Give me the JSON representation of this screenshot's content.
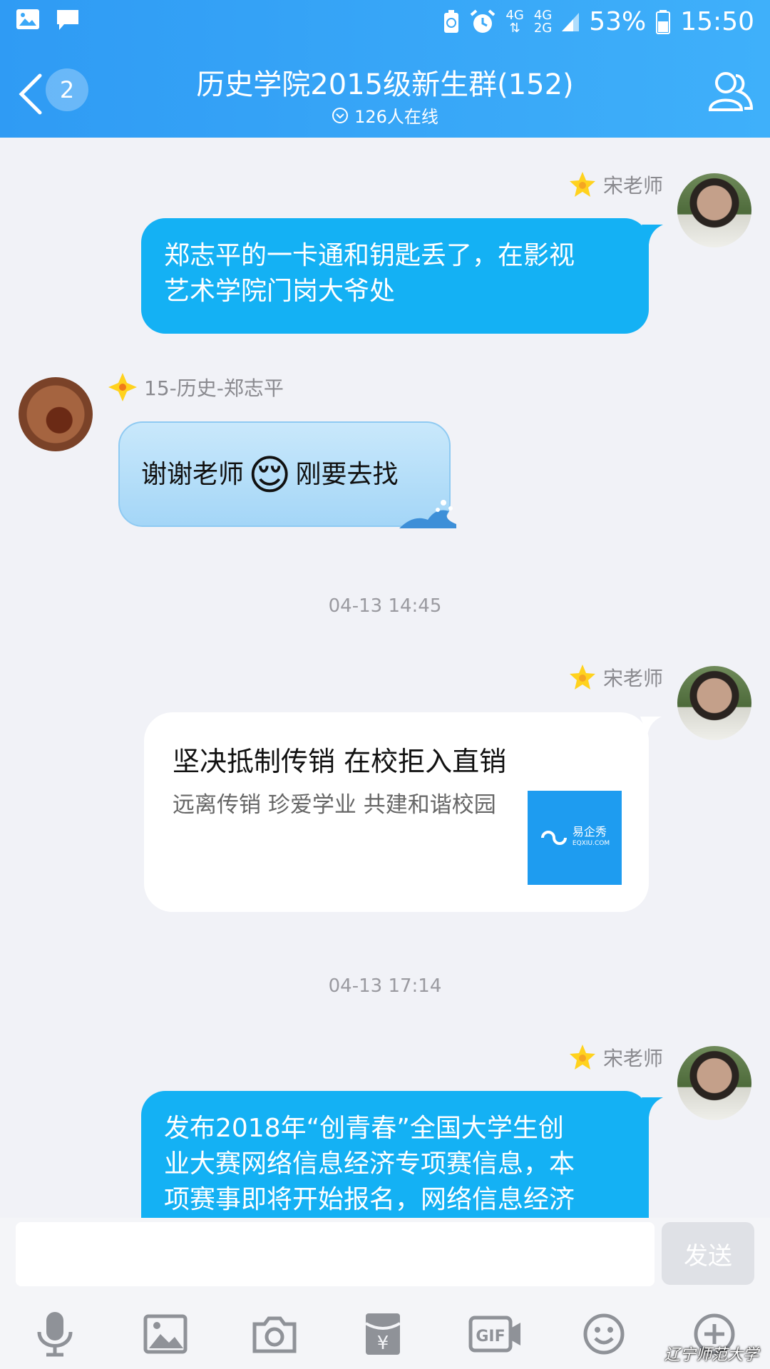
{
  "status_bar": {
    "net1_top": "4G",
    "net2_top": "4G",
    "net2_bottom": "2G",
    "battery": "53%",
    "time": "15:50"
  },
  "header": {
    "unread_count": "2",
    "title": "历史学院2015级新生群(152)",
    "online": "126人在线"
  },
  "messages": [
    {
      "sender": "宋老师",
      "text_line1": "郑志平的一卡通和钥匙丢了，在影视",
      "text_line2": "艺术学院门岗大爷处"
    },
    {
      "sender": "15-历史-郑志平",
      "text_before": "谢谢老师",
      "emoji": "😌",
      "text_after": "刚要去找"
    },
    {
      "timestamp": "04-13 14:45"
    },
    {
      "sender": "宋老师",
      "card_title": "坚决抵制传销 在校拒入直销",
      "card_desc": "远离传销 珍爱学业 共建和谐校园",
      "card_thumb_brand": "易企秀",
      "card_thumb_domain": "EQXIU.COM"
    },
    {
      "timestamp": "04-13 17:14"
    },
    {
      "sender": "宋老师",
      "text_line1": "发布2018年“创青春”全国大学生创",
      "text_line2": "业大赛网络信息经济专项赛信息，本",
      "text_line3": "项赛事即将开始报名，网络信息经济"
    }
  ],
  "input": {
    "send_label": "发送",
    "placeholder": ""
  },
  "toolbar": {
    "icons": [
      "microphone-icon",
      "image-icon",
      "camera-icon",
      "red-packet-icon",
      "gif-icon",
      "emoji-icon",
      "plus-icon"
    ],
    "gif_label": "GIF",
    "yuan_label": "¥"
  },
  "watermark": "辽宁师范大学",
  "colors": {
    "header": "#3ba8f8",
    "bubble_blue": "#14b1f4",
    "background": "#f1f2f7",
    "send_disabled": "#dfe1e6"
  }
}
